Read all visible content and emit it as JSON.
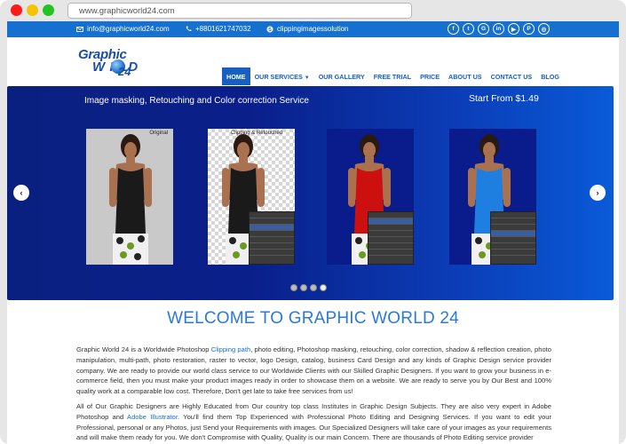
{
  "browser": {
    "url": "www.graphicworld24.com"
  },
  "topbar": {
    "email": "info@graphicworld24.com",
    "phone": "+8801621747032",
    "skype": "clippingimagessolution",
    "social_icons": [
      "facebook-icon",
      "twitter-icon",
      "google-plus-icon",
      "linkedin-icon",
      "youtube-icon",
      "pinterest-icon",
      "instagram-icon"
    ],
    "social_glyphs": [
      "f",
      "t",
      "G",
      "in",
      "▶",
      "P",
      "◎"
    ]
  },
  "logo": {
    "line1": "Graphic",
    "line2": "W  RLD",
    "line3": "24"
  },
  "nav": [
    "HOME",
    "OUR SERVICES",
    "OUR GALLERY",
    "FREE TRIAL",
    "PRICE",
    "ABOUT US",
    "CONTACT US",
    "BLOG"
  ],
  "slider": {
    "title": "Image masking, Retouching and Color correction Service",
    "price": "Start From $1.49",
    "panel_labels": [
      "Original",
      "Clipping & Retouched"
    ],
    "prev": "‹",
    "next": "›",
    "dot_count": 4,
    "active_dot": 3
  },
  "content": {
    "heading": "WELCOME TO GRAPHIC WORLD 24",
    "p1_before": "Graphic World 24 is a Worldwide Photoshop ",
    "p1_link": "Clipping path",
    "p1_after": ", photo editing, Photoshop masking, retouching, color correction, shadow & reflection creation, photo manipulation, multi-path, photo restoration, raster to vector, logo Design, catalog, business Card Design and any kinds of Graphic Design service provider company. We are ready to provide our world class service to our Worldwide Clients with our Skilled Graphic Designers. If you want to grow your business in e-commerce field, then you must make your product images ready in order to showcase them on a website. We are ready to serve you by Our Best and 100% quality work at a comparable low cost. Therefore, Don't get late to take free services from us!",
    "p2_before": "All of Our Graphic Designers are Highly Educated from Our country top class Institutes in Graphic Design Subjects. They are also very expert in Adobe Photoshop and ",
    "p2_link": "Adobe Illustrator",
    "p2_after": ". You'll find them Top Experienced with Professional Photo Editing and Designing Services. If you want to edit your Professional, personal or any Photos, just Send your Requirements with images. Our Specialized Designers will take care of your images as your requirements and will make them ready for you. We don't Compromise with Quality, Quality is our main Concern. There are thousands of Photo Editing service provider"
  },
  "colors": {
    "brand_blue": "#1670d0",
    "nav_text": "#1560c0",
    "heading": "#2a7ad4",
    "slider_dark": "#0a2080",
    "slider_light": "#0a5ad8",
    "dress_red": "#cc1010",
    "dress_blue": "#1e7fe0",
    "dress_black": "#1a1a1a"
  }
}
